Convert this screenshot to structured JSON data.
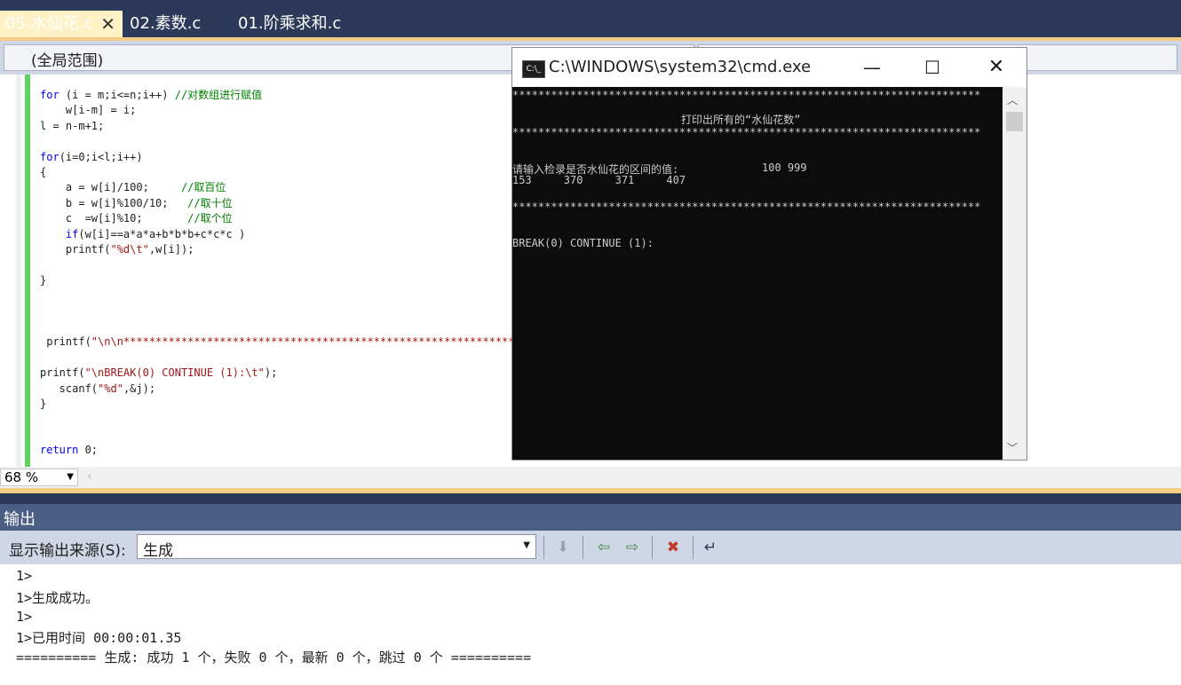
{
  "tabs": [
    {
      "label": "05.水仙花.c",
      "active": true,
      "close": "✕"
    },
    {
      "label": "02.素数.c",
      "active": false
    },
    {
      "label": "01.阶乘求和.c",
      "active": false
    }
  ],
  "scope": {
    "label": "(全局范围)"
  },
  "code": [
    {
      "t": "for",
      "c": " (i = m;i<=n;i++) ",
      "m": "//对数组进行赋值"
    },
    {
      "c": "    w[i-m] = i;"
    },
    {
      "c": "l = n-m+1;"
    },
    {
      "c": ""
    },
    {
      "t": "for",
      "c": "(i=0;i<l;i++)"
    },
    {
      "c": "{"
    },
    {
      "c": "    a = w[i]/100;     ",
      "m": "//取百位"
    },
    {
      "c": "    b = w[i]%100/10;   ",
      "m": "//取十位"
    },
    {
      "c": "    c  =w[i]%10;       ",
      "m": "//取个位"
    },
    {
      "t": "    if",
      "c": "(w[i]==a*a*a+b*b*b+c*c*c )"
    },
    {
      "c": "    printf(",
      "s": "\"%d\\t\"",
      "e": ",w[i]);"
    },
    {
      "c": ""
    },
    {
      "c": "}"
    },
    {
      "c": ""
    },
    {
      "c": ""
    },
    {
      "c": ""
    },
    {
      "c": " printf(",
      "s": "\"\\n\\n**************************************************************"
    },
    {
      "c": ""
    },
    {
      "c": "printf(",
      "s": "\"\\nBREAK(0) CONTINUE (1):\\t\"",
      "e": ");"
    },
    {
      "c": "   scanf(",
      "s": "\"%d\"",
      "e": ",&j);"
    },
    {
      "c": "}"
    },
    {
      "c": ""
    },
    {
      "c": ""
    },
    {
      "t": "return",
      "c": " 0;"
    }
  ],
  "zoom": {
    "value": "68 %"
  },
  "output": {
    "title": "输出",
    "source_label": "显示输出来源(S):",
    "source_value": "生成",
    "lines": [
      "1>",
      "1>生成成功。",
      "1>",
      "1>已用时间 00:00:01.35",
      "========== 生成: 成功 1 个，失败 0 个，最新 0 个，跳过 0 个 =========="
    ]
  },
  "cmd": {
    "title": "C:\\WINDOWS\\system32\\cmd.exe",
    "icon_text": "C:\\_",
    "min": "—",
    "max": "☐",
    "close": "✕",
    "stars": "*************************************************************************",
    "heading": "打印出所有的“水仙花数”",
    "prompt_label": "请输入检录是否水仙花的区间的值:",
    "prompt_value": "100 999",
    "results": "153     370     371     407",
    "break_prompt": "BREAK(0) CONTINUE (1):"
  }
}
